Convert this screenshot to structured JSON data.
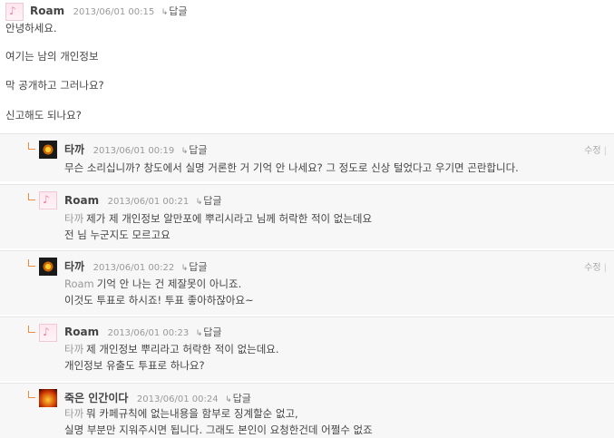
{
  "comments": [
    {
      "author": "Roam",
      "date": "2013/06/01 00:15",
      "reply_label": "답글",
      "reply_arrow": "↳",
      "lines": [
        "안녕하세요.",
        "여기는 남의 개인정보",
        "막 공개하고 그러나요?",
        "신고해도 되나요?"
      ]
    },
    {
      "author": "타까",
      "date": "2013/06/01 00:19",
      "reply_label": "답글",
      "edit_label": "수정",
      "edit_sep": "|",
      "lines": [
        "무슨 소리십니까? 창도에서 실명 거론한 거 기억 안 나세요? 그 정도로 신상 털었다고 우기면 곤란합니다."
      ]
    },
    {
      "author": "Roam",
      "date": "2013/06/01 00:21",
      "reply_label": "답글",
      "mention": "타까",
      "lines": [
        "제가 제 개인정보 알만포에 뿌리시라고 님께 허락한 적이 없는데요",
        "전 님 누군지도 모르고요"
      ]
    },
    {
      "author": "타까",
      "date": "2013/06/01 00:22",
      "reply_label": "답글",
      "edit_label": "수정",
      "edit_sep": "|",
      "mention": "Roam",
      "lines": [
        "기억 안 나는 건 제잘못이 아니죠.",
        "이것도 투표로 하시죠! 투표 좋아하잖아요~"
      ]
    },
    {
      "author": "Roam",
      "date": "2013/06/01 00:23",
      "reply_label": "답글",
      "mention": "타까",
      "lines": [
        "제 개인정보 뿌리라고 허락한 적이 없는데요.",
        "개인정보 유출도 투표로 하나요?"
      ]
    },
    {
      "author": "죽은 인간이다",
      "date": "2013/06/01 00:24",
      "reply_label": "답글",
      "mention": "타까",
      "lines": [
        "뭐 카페규칙에 없는내용을 함부로 징계할순 없고,",
        "실명 부분만 지워주시면 됩니다. 그래도 본인이 요청한건데 어쩔수 없죠"
      ]
    }
  ]
}
